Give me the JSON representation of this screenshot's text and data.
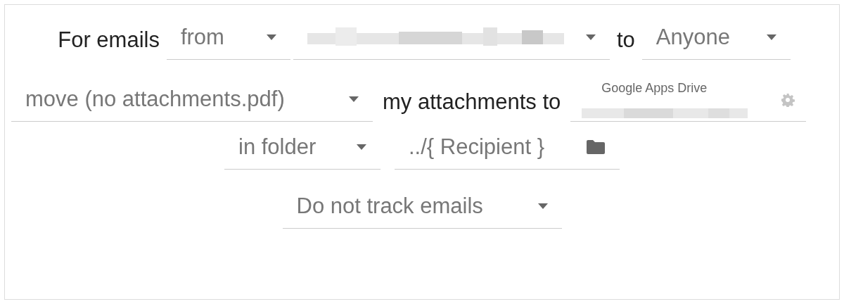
{
  "rows": [
    {
      "items": [
        {
          "kind": "label",
          "text": "For emails"
        },
        {
          "kind": "select",
          "value": "from"
        },
        {
          "kind": "redacted-select"
        },
        {
          "kind": "label",
          "text": "to"
        },
        {
          "kind": "select",
          "value": "Anyone"
        }
      ]
    },
    {
      "items": [
        {
          "kind": "select",
          "value": "move (no attachments.pdf)"
        },
        {
          "kind": "label",
          "text": "my attachments to"
        },
        {
          "kind": "drive-field",
          "label": "Google Apps Drive"
        }
      ]
    },
    {
      "items": [
        {
          "kind": "select",
          "value": "in folder"
        },
        {
          "kind": "folder-input",
          "value": "../{ Recipient }"
        }
      ]
    },
    {
      "items": [
        {
          "kind": "select",
          "value": "Do not track emails"
        }
      ]
    }
  ]
}
